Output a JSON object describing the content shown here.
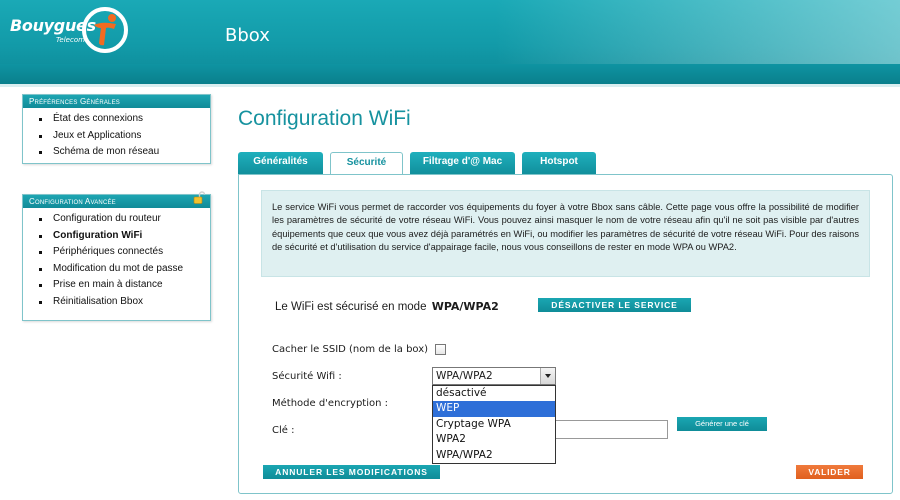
{
  "header": {
    "brand": "Bouygues",
    "brand_sub": "Telecom",
    "app_title": "Bbox",
    "logo_colors": {
      "ring": "#ffffff",
      "figure": "#f26b21"
    }
  },
  "sidebar": {
    "general": {
      "title": "Préférences Générales",
      "items": [
        {
          "label": "État des connexions"
        },
        {
          "label": "Jeux et Applications"
        },
        {
          "label": "Schéma de mon réseau"
        }
      ]
    },
    "advanced": {
      "title": "Configuration Avancée",
      "lock_icon": "lock-icon",
      "items": [
        {
          "label": "Configuration du routeur"
        },
        {
          "label": "Configuration WiFi",
          "active": true
        },
        {
          "label": "Périphériques connectés"
        },
        {
          "label": "Modification du mot de passe"
        },
        {
          "label": "Prise en main à distance"
        },
        {
          "label": "Réinitialisation Bbox"
        }
      ]
    }
  },
  "main": {
    "title": "Configuration WiFi",
    "tabs": [
      {
        "label": "Généralités"
      },
      {
        "label": "Sécurité",
        "active": true
      },
      {
        "label": "Filtrage d'@ Mac"
      },
      {
        "label": "Hotspot"
      }
    ],
    "info_text": "Le service WiFi vous permet de raccorder vos équipements du foyer à votre Bbox sans câble. Cette page vous offre la possibilité de modifier les paramètres de sécurité de votre réseau WiFi. Vous pouvez ainsi masquer le nom de votre réseau afin qu'il ne soit pas visible par d'autres équipements que ceux que vous avez déjà paramétrés en WiFi, ou modifier les paramètres de sécurité de votre réseau WiFi. Pour des raisons de sécurité et d'utilisation du service d'appairage facile, nous vous conseillons de rester en mode WPA ou WPA2.",
    "status_text": "Le WiFi est sécurisé en mode",
    "status_mode": "WPA/WPA2",
    "disable_button": "DÉSACTIVER LE SERVICE",
    "form": {
      "hide_ssid_label": "Cacher le SSID (nom de la box)",
      "hide_ssid_checked": false,
      "security_label": "Sécurité Wifi :",
      "security_value": "WPA/WPA2",
      "security_options": [
        "désactivé",
        "WEP",
        "Cryptage WPA",
        "WPA2",
        "WPA/WPA2"
      ],
      "highlighted_option": "WEP",
      "encryption_label": "Méthode d'encryption :",
      "key_label": "Clé :",
      "key_value": "",
      "generate_key_button": "Générer une clé"
    },
    "cancel_button": "ANNULER LES MODIFICATIONS",
    "validate_button": "VALIDER"
  },
  "colors": {
    "teal": "#129aa8",
    "accent_orange": "#e0601f",
    "title_teal": "#16929f",
    "info_bg": "#dff0f1",
    "highlight_blue": "#2e6fd8"
  }
}
